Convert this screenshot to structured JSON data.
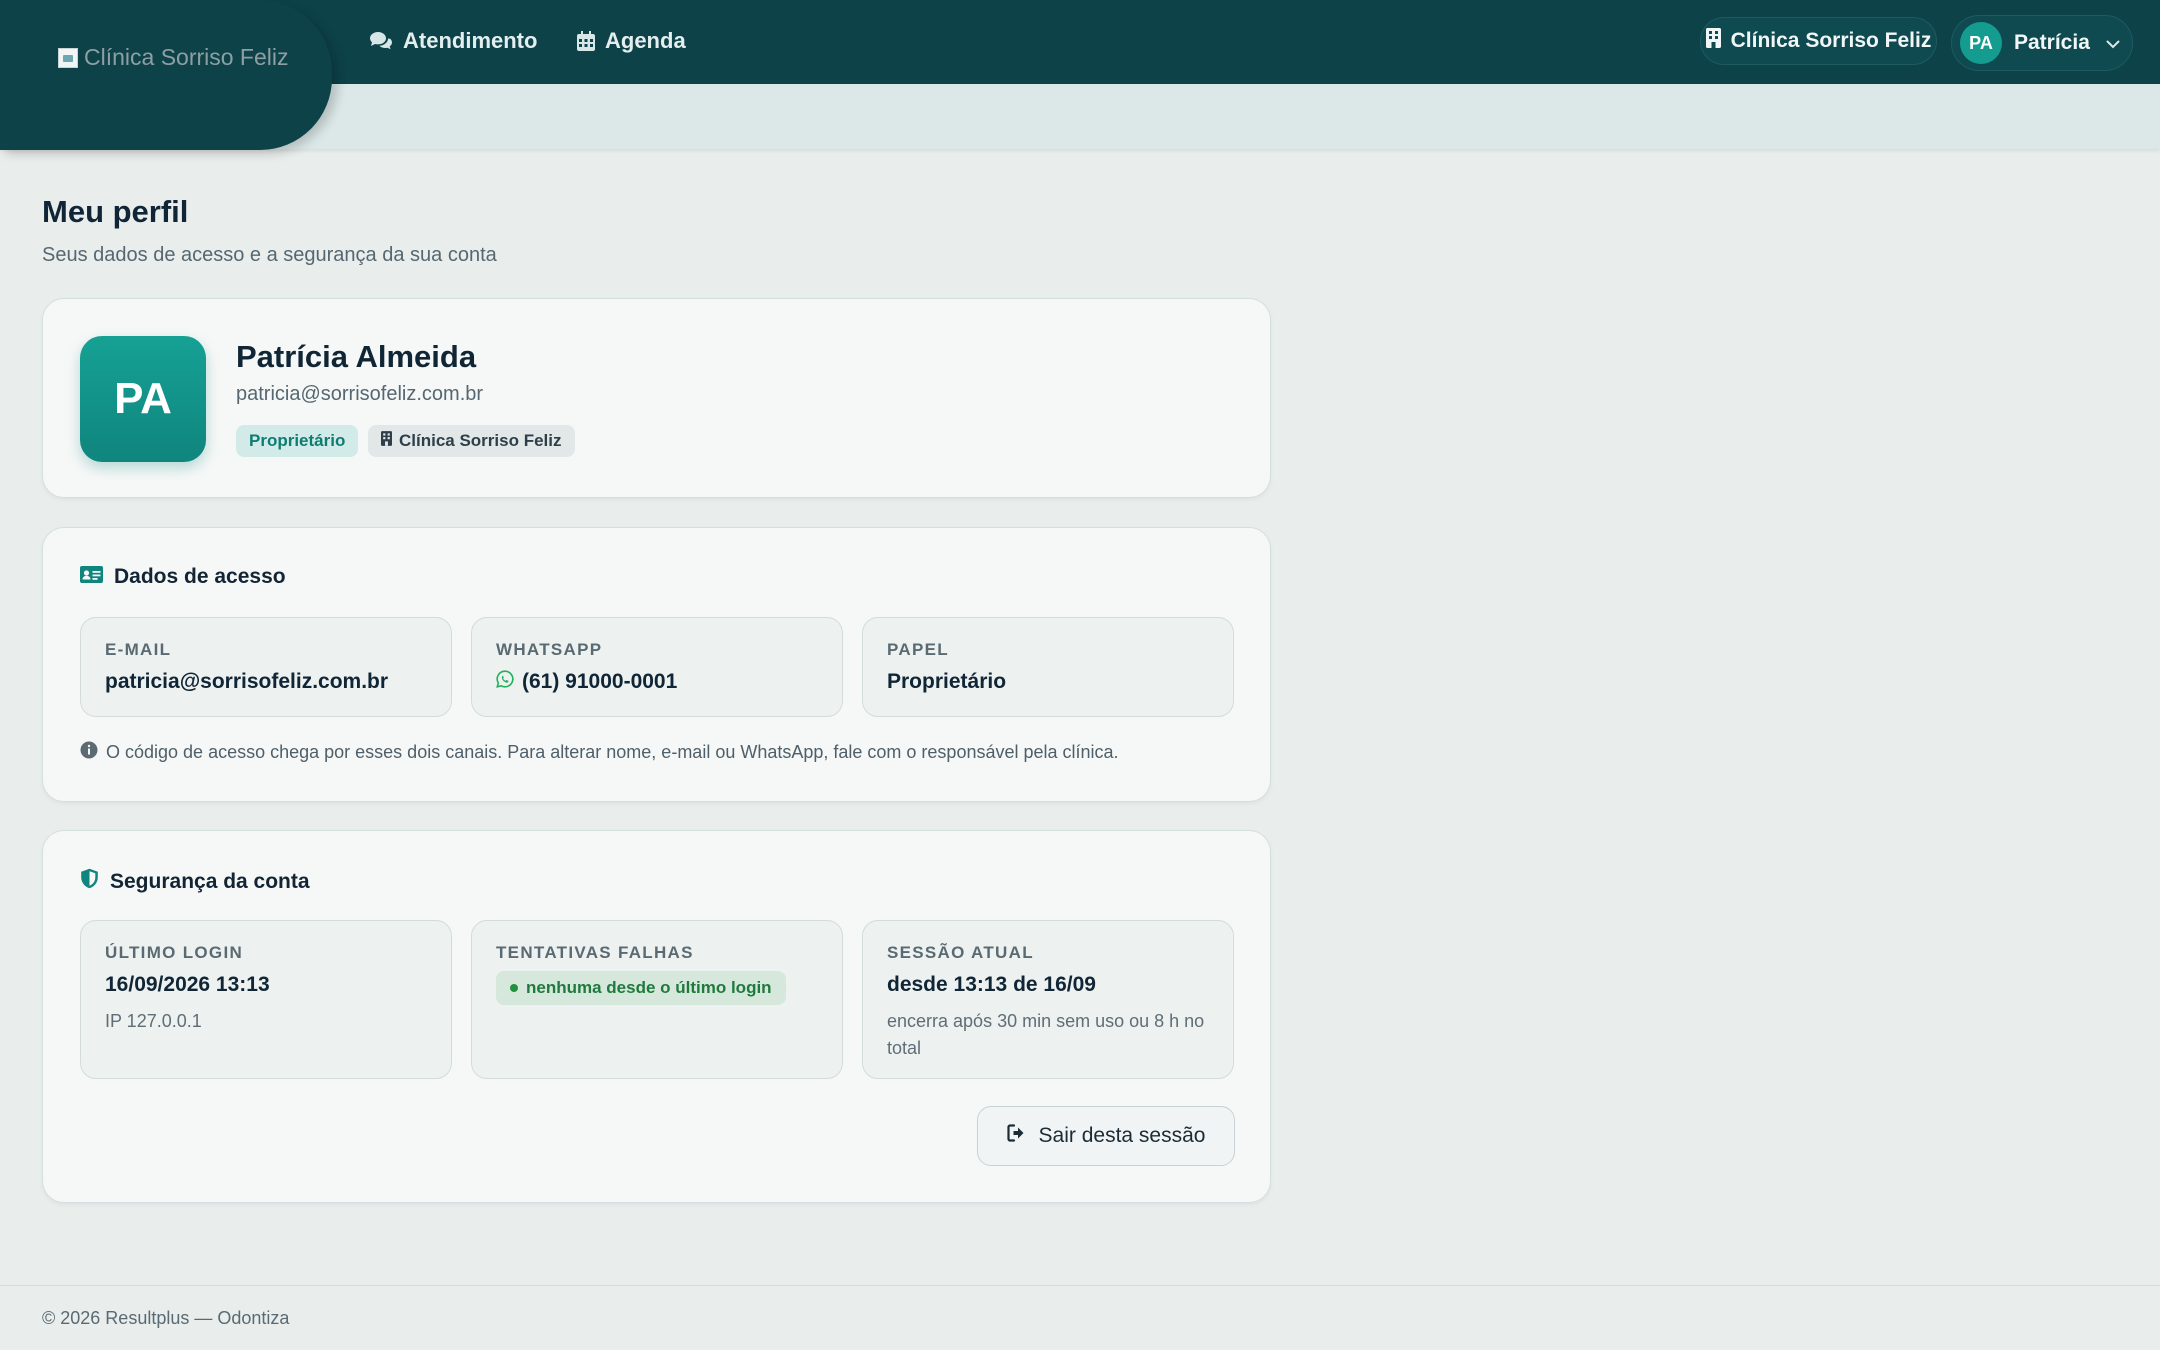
{
  "header": {
    "logo_alt": "Clínica Sorriso Feliz",
    "nav": [
      {
        "label": "Atendimento",
        "icon": "chat-bubbles-icon"
      },
      {
        "label": "Agenda",
        "icon": "calendar-icon"
      }
    ],
    "clinic_switcher": {
      "label": "Clínica Sorriso Feliz",
      "icon": "building-icon"
    },
    "user_menu": {
      "initials": "PA",
      "name": "Patrícia",
      "icon": "chevron-down-icon"
    }
  },
  "page": {
    "title": "Meu perfil",
    "subtitle": "Seus dados de acesso e a segurança da sua conta"
  },
  "profile": {
    "initials": "PA",
    "name": "Patrícia Almeida",
    "email": "patricia@sorrisofeliz.com.br",
    "role_badge": "Proprietário",
    "clinic_badge": "Clínica Sorriso Feliz"
  },
  "access": {
    "heading": "Dados de acesso",
    "fields": [
      {
        "label": "E-MAIL",
        "value": "patricia@sorrisofeliz.com.br"
      },
      {
        "label": "WHATSAPP",
        "value": "(61) 91000-0001",
        "icon": "whatsapp-icon"
      },
      {
        "label": "PAPEL",
        "value": "Proprietário"
      }
    ],
    "note": "O código de acesso chega por esses dois canais. Para alterar nome, e-mail ou WhatsApp, fale com o responsável pela clínica."
  },
  "security": {
    "heading": "Segurança da conta",
    "last_login": {
      "label": "ÚLTIMO LOGIN",
      "value": "16/09/2026 13:13",
      "sub": "IP 127.0.0.1"
    },
    "failed_attempts": {
      "label": "TENTATIVAS FALHAS",
      "status": "nenhuma desde o último login"
    },
    "current_session": {
      "label": "SESSÃO ATUAL",
      "value": "desde 13:13 de 16/09",
      "sub": "encerra após 30 min sem uso ou 8 h no total"
    },
    "logout_label": "Sair desta sessão"
  },
  "footer": {
    "text": "© 2026 Resultplus — Odontiza"
  },
  "colors": {
    "brand_dark": "#0d4249",
    "accent": "#149c91",
    "success": "#22913f"
  }
}
